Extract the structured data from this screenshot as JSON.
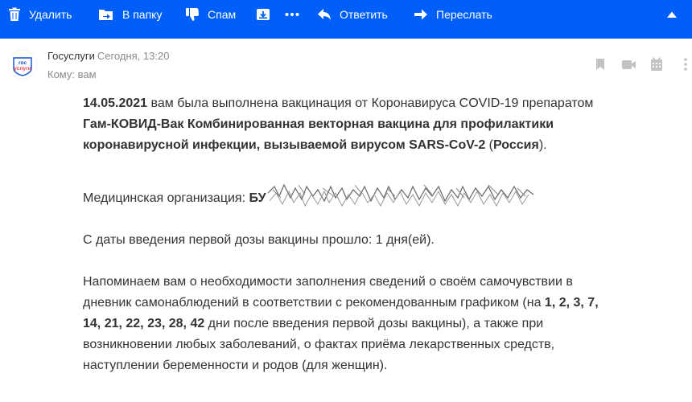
{
  "toolbar": {
    "delete_label": "Удалить",
    "folder_label": "В папку",
    "spam_label": "Спам",
    "reply_label": "Ответить",
    "forward_label": "Переслать"
  },
  "colors": {
    "toolbar_bg": "#005ff9",
    "text": "#333333",
    "muted": "#8a8a8a",
    "icon_gray": "#c2c2c2"
  },
  "icons": {
    "delete": "trash-icon",
    "folder": "move-folder-icon",
    "spam": "thumbs-down-icon",
    "archive": "archive-icon",
    "more": "dots-icon",
    "reply": "reply-arrow-icon",
    "forward": "forward-arrow-icon",
    "collapse": "triangle-up-icon",
    "bookmark": "bookmark-icon",
    "video": "video-camera-icon",
    "calendar": "calendar-icon",
    "kebab": "vertical-dots-icon"
  },
  "message": {
    "sender_name": "Госуслуги",
    "date": "Сегодня, 13:20",
    "recipient": "Кому: вам",
    "avatar_logo": "гос услуги"
  },
  "body": {
    "p1": {
      "date_bold": "14.05.2021",
      "t1": " вам была выполнена вакцинация от Коронавируса COVID-19 препаратом ",
      "vaccine_bold": "Гам-КОВИД-Вак Комбинированная векторная вакцина для профилактики коронавирусной инфекции, вызываемой вирусом SARS-CoV-2",
      "t2": " (",
      "country_bold": "Россия",
      "t3": ")."
    },
    "p2": {
      "label": "Медицинская организация: ",
      "org_bold": "БУ"
    },
    "p3": "С даты введения первой дозы вакцины прошло: 1 дня(ей).",
    "p4": {
      "t1": "Напоминаем вам о необходимости заполнения сведений о своём самочувствии в дневник самонаблюдений в соответствии с рекомендованным графиком (на ",
      "days_bold": "1, 2, 3, 7, 14, 21, 22, 23, 28, 42",
      "t2": " дни после введения первой дозы вакцины), а также при возникновении любых заболеваний, о фактах приёма лекарственных средств, наступлении беременности и родов (для женщин)."
    }
  }
}
